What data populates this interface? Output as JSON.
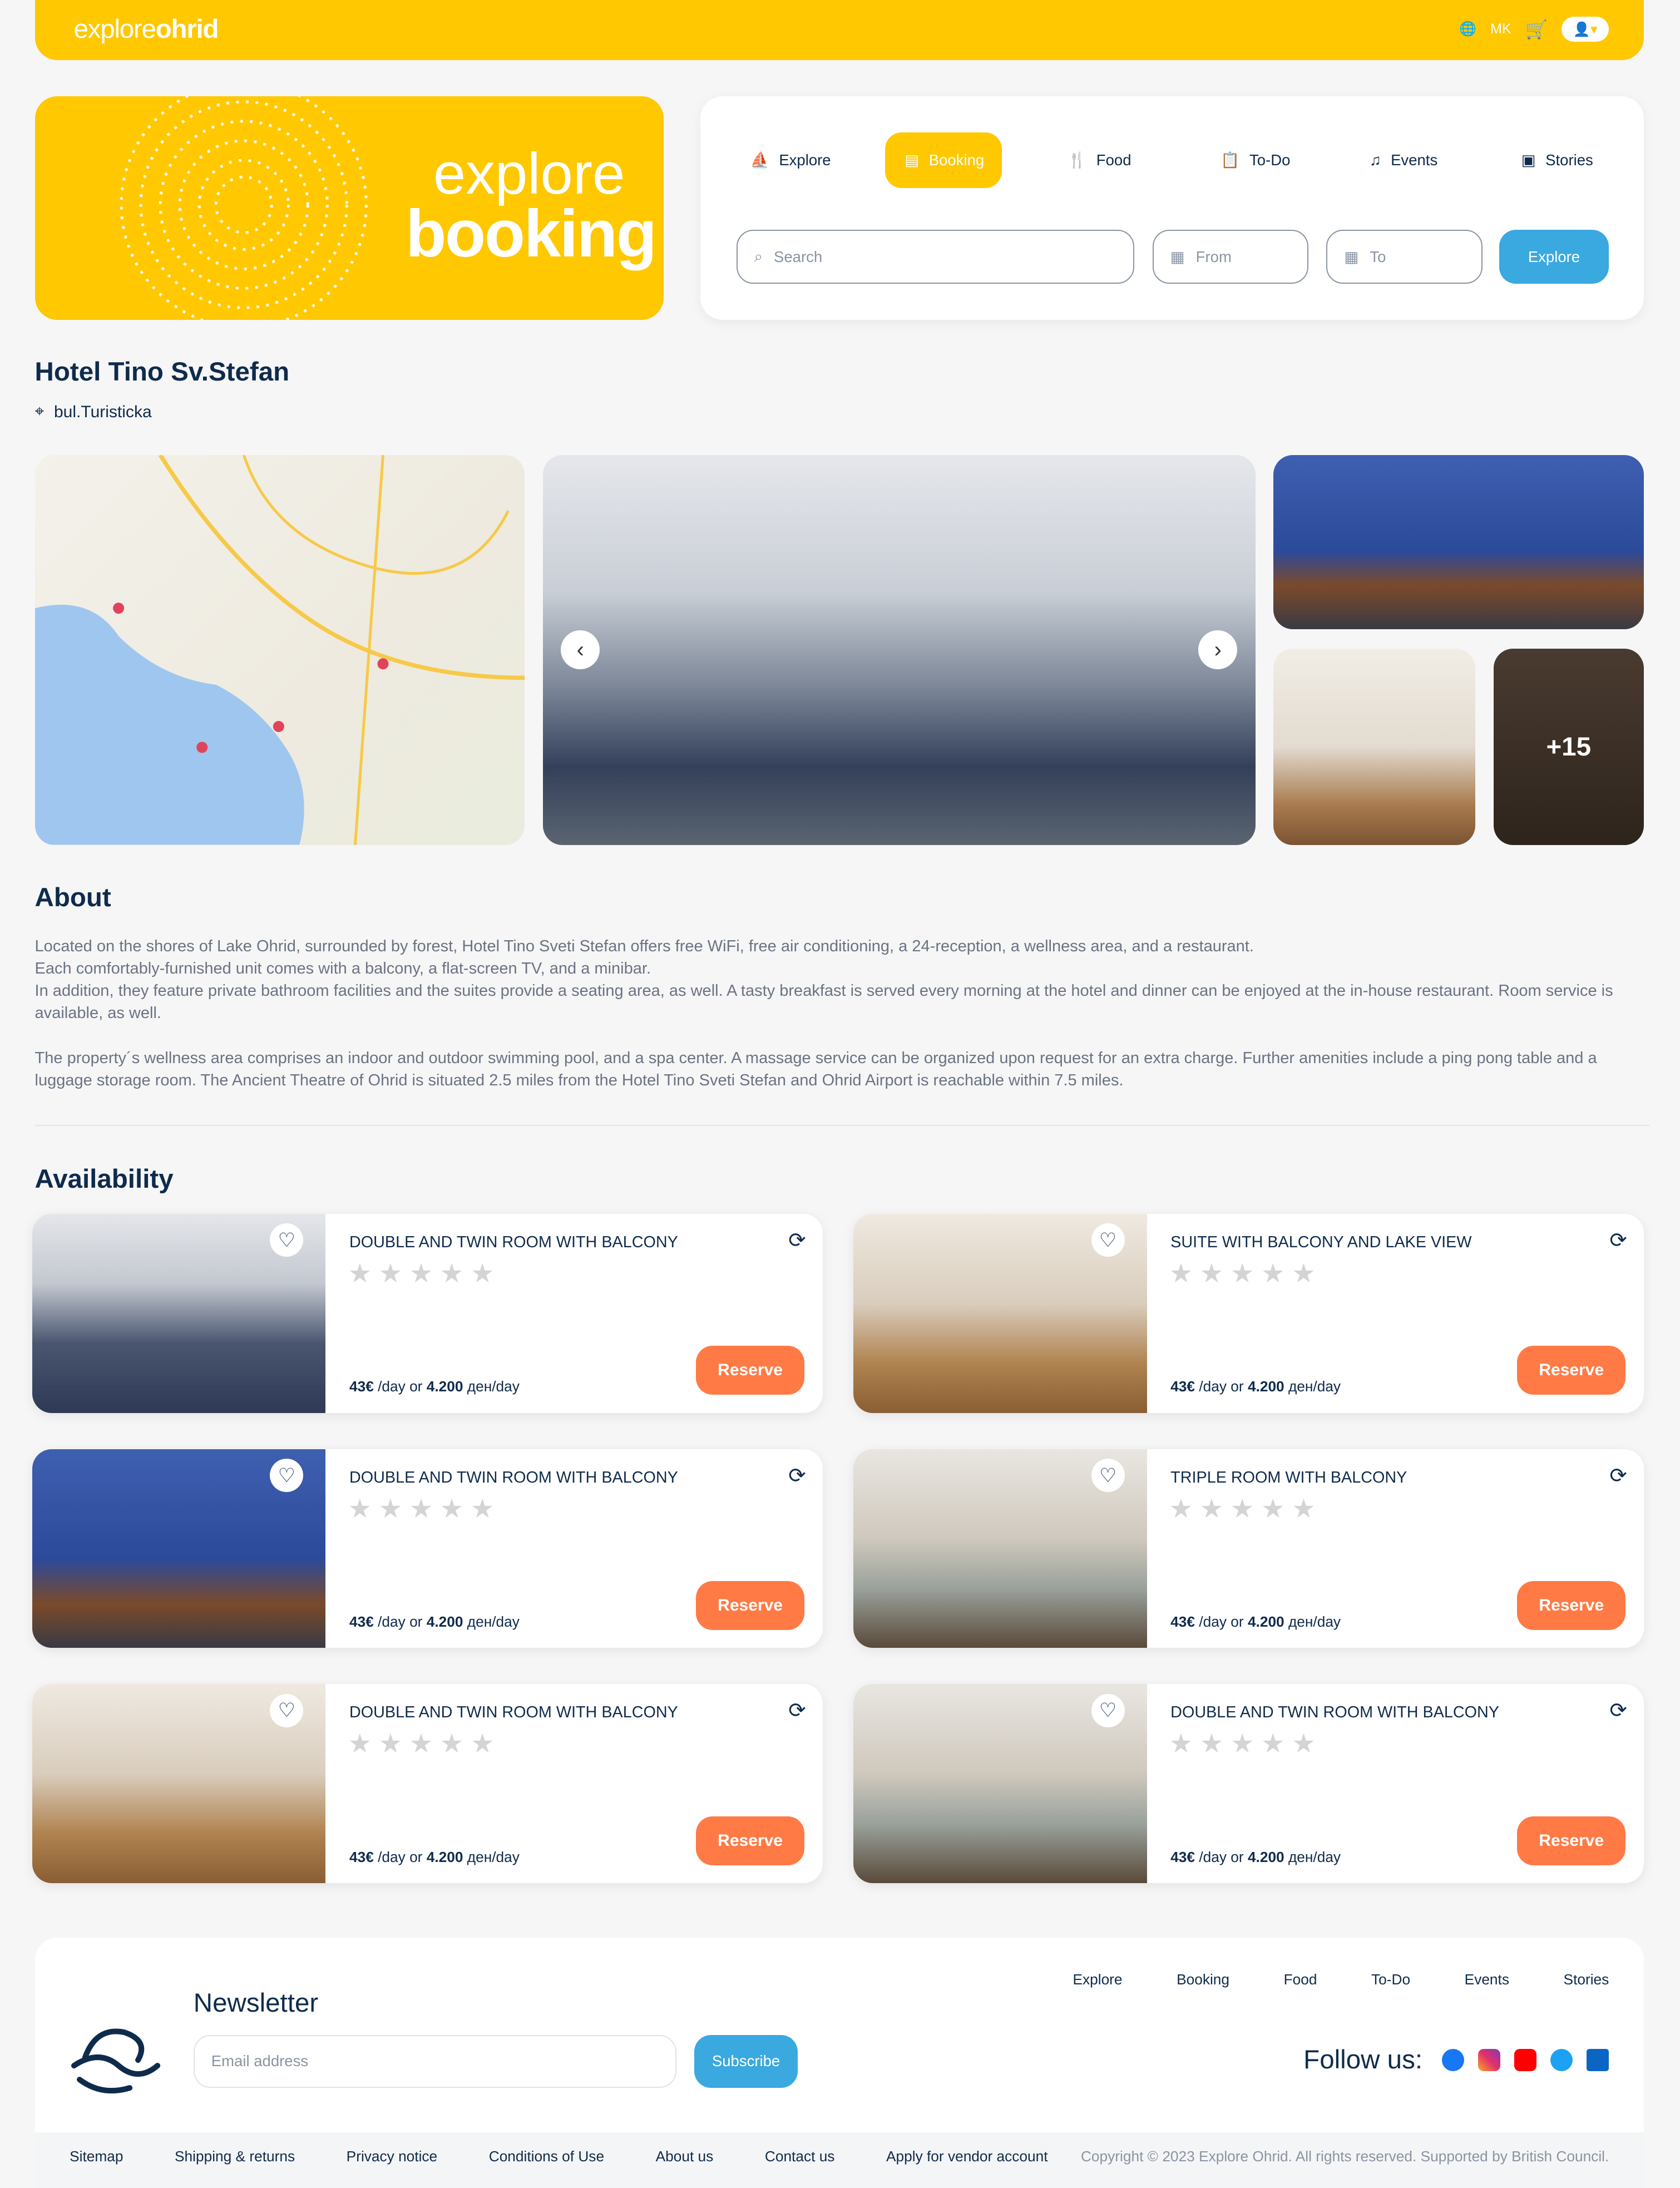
{
  "header": {
    "logo_light": "explore",
    "logo_bold": "ohrid",
    "language": "MK"
  },
  "hero": {
    "line1": "explore",
    "line2": "booking"
  },
  "nav_tabs": [
    {
      "label": "Explore",
      "icon": "boat-icon"
    },
    {
      "label": "Booking",
      "icon": "calendar-icon",
      "active": true
    },
    {
      "label": "Food",
      "icon": "utensils-icon"
    },
    {
      "label": "To-Do",
      "icon": "clipboard-icon"
    },
    {
      "label": "Events",
      "icon": "music-icon"
    },
    {
      "label": "Stories",
      "icon": "book-icon"
    }
  ],
  "search": {
    "placeholder": "Search",
    "from_placeholder": "From",
    "to_placeholder": "To",
    "button": "Explore"
  },
  "hotel": {
    "name": "Hotel Tino Sv.Stefan",
    "address": "bul.Turisticka"
  },
  "gallery": {
    "more_count": "+15"
  },
  "about": {
    "heading": "About",
    "paragraphs": [
      "Located on the shores of Lake Ohrid, surrounded by forest, Hotel Tino Sveti Stefan offers free WiFi, free air conditioning, a 24-reception, a wellness area, and a restaurant.",
      "Each comfortably-furnished unit comes with a balcony, a flat-screen TV, and a minibar.",
      "In addition, they feature private bathroom facilities and the suites provide a seating area, as well. A tasty breakfast is served every morning at the hotel and dinner can be enjoyed at the in-house restaurant. Room service is available, as well.",
      "The property´s wellness area comprises an indoor and outdoor swimming pool, and a spa center. A massage service can be organized upon request for an extra charge. Further amenities include a ping pong table and a luggage storage room. The Ancient Theatre of Ohrid is situated 2.5 miles from the Hotel Tino Sveti Stefan and Ohrid Airport is reachable within 7.5 miles."
    ]
  },
  "availability": {
    "heading": "Availability",
    "reserve_label": "Reserve",
    "rooms": [
      {
        "name": "DOUBLE AND TWIN ROOM WITH BALCONY",
        "price_eur": "43€",
        "per_day": "/day or",
        "price_mkd": "4.200",
        "mkd_unit": "ден/day",
        "rating": 0
      },
      {
        "name": "SUITE WITH BALCONY AND LAKE VIEW",
        "price_eur": "43€",
        "per_day": "/day or",
        "price_mkd": "4.200",
        "mkd_unit": "ден/day",
        "rating": 0
      },
      {
        "name": "DOUBLE AND TWIN ROOM WITH BALCONY",
        "price_eur": "43€",
        "per_day": "/day or",
        "price_mkd": "4.200",
        "mkd_unit": "ден/day",
        "rating": 0
      },
      {
        "name": "TRIPLE ROOM WITH BALCONY",
        "price_eur": "43€",
        "per_day": "/day or",
        "price_mkd": "4.200",
        "mkd_unit": "ден/day",
        "rating": 0
      },
      {
        "name": "DOUBLE AND TWIN ROOM WITH BALCONY",
        "price_eur": "43€",
        "per_day": "/day or",
        "price_mkd": "4.200",
        "mkd_unit": "ден/day",
        "rating": 0
      },
      {
        "name": "DOUBLE AND TWIN ROOM WITH BALCONY",
        "price_eur": "43€",
        "per_day": "/day or",
        "price_mkd": "4.200",
        "mkd_unit": "ден/day",
        "rating": 0
      }
    ]
  },
  "footer": {
    "newsletter": "Newsletter",
    "email_placeholder": "Email address",
    "subscribe": "Subscribe",
    "follow": "Follow us:",
    "nav": [
      "Explore",
      "Booking",
      "Food",
      "To-Do",
      "Events",
      "Stories"
    ],
    "bottom_links": [
      "Sitemap",
      "Shipping & returns",
      "Privacy notice",
      "Conditions of Use",
      "About us",
      "Contact us",
      "Apply for vendor account"
    ],
    "copyright": "Copyright © 2023 Explore Ohrid. All rights reserved. Supported by British Council."
  },
  "colors": {
    "brand_yellow": "#FFC800",
    "navy": "#0F2B4C",
    "accent_blue": "#3AA9DF",
    "reserve_orange": "#FF7A45"
  }
}
